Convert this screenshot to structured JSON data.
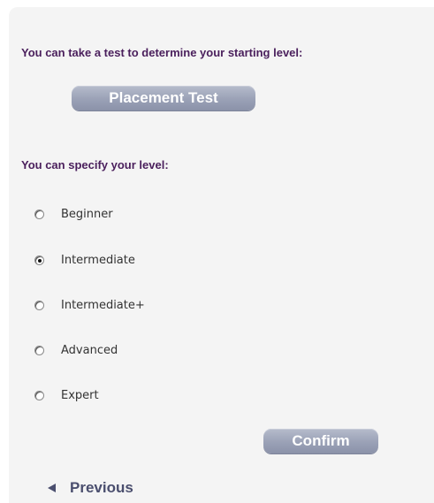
{
  "placement": {
    "heading": "You can take a test to determine your starting level:",
    "button_label": "Placement Test"
  },
  "level": {
    "heading": "You can specify your level:",
    "options": [
      {
        "label": "Beginner",
        "checked": false
      },
      {
        "label": "Intermediate",
        "checked": true
      },
      {
        "label": "Intermediate+",
        "checked": false
      },
      {
        "label": "Advanced",
        "checked": false
      },
      {
        "label": "Expert",
        "checked": false
      }
    ],
    "confirm_label": "Confirm"
  },
  "nav": {
    "previous_label": "Previous"
  },
  "colors": {
    "heading": "#4a1f5c",
    "button": "#9aa1b6",
    "link": "#4a4e6e",
    "panel": "#f4f4f4"
  }
}
